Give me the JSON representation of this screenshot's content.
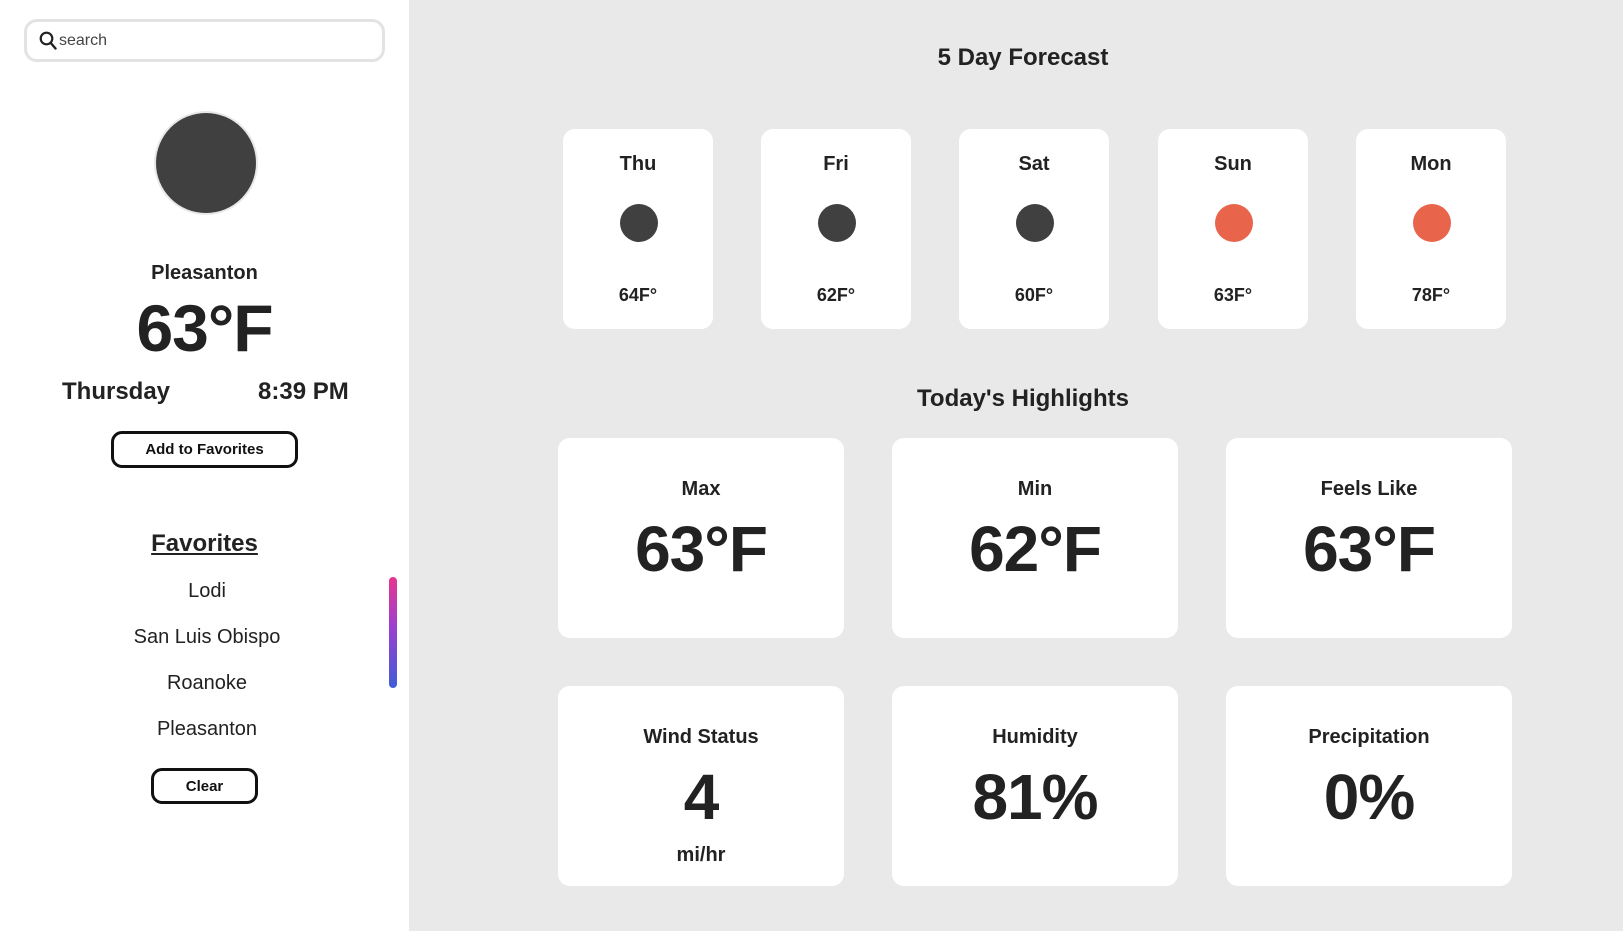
{
  "search": {
    "placeholder": "search"
  },
  "current": {
    "icon": "moon-icon",
    "icon_color": "#404040",
    "city": "Pleasanton",
    "temperature": "63°F",
    "day": "Thursday",
    "time": "8:39 PM"
  },
  "buttons": {
    "add_favorite": "Add to Favorites",
    "clear": "Clear"
  },
  "favorites": {
    "heading": "Favorites",
    "items": [
      "Lodi",
      "San Luis Obispo",
      "Roanoke",
      "Pleasanton"
    ]
  },
  "forecast": {
    "title": "5 Day Forecast",
    "days": [
      {
        "day": "Thu",
        "temp": "64F°",
        "icon": "moon-icon",
        "color": "#404040"
      },
      {
        "day": "Fri",
        "temp": "62F°",
        "icon": "moon-icon",
        "color": "#404040"
      },
      {
        "day": "Sat",
        "temp": "60F°",
        "icon": "moon-icon",
        "color": "#404040"
      },
      {
        "day": "Sun",
        "temp": "63F°",
        "icon": "sun-icon",
        "color": "#e8644a"
      },
      {
        "day": "Mon",
        "temp": "78F°",
        "icon": "sun-icon",
        "color": "#e8644a"
      }
    ]
  },
  "highlights": {
    "title": "Today's Highlights",
    "max": {
      "label": "Max",
      "value": "63°F"
    },
    "min": {
      "label": "Min",
      "value": "62°F"
    },
    "feels_like": {
      "label": "Feels Like",
      "value": "63°F"
    },
    "wind": {
      "label": "Wind Status",
      "value": "4",
      "unit": "mi/hr"
    },
    "humidity": {
      "label": "Humidity",
      "value": "81%"
    },
    "precipitation": {
      "label": "Precipitation",
      "value": "0%"
    }
  },
  "colors": {
    "main_background": "#e9e9e9",
    "card_background": "#ffffff",
    "night_icon": "#404040",
    "day_icon": "#e8644a"
  }
}
